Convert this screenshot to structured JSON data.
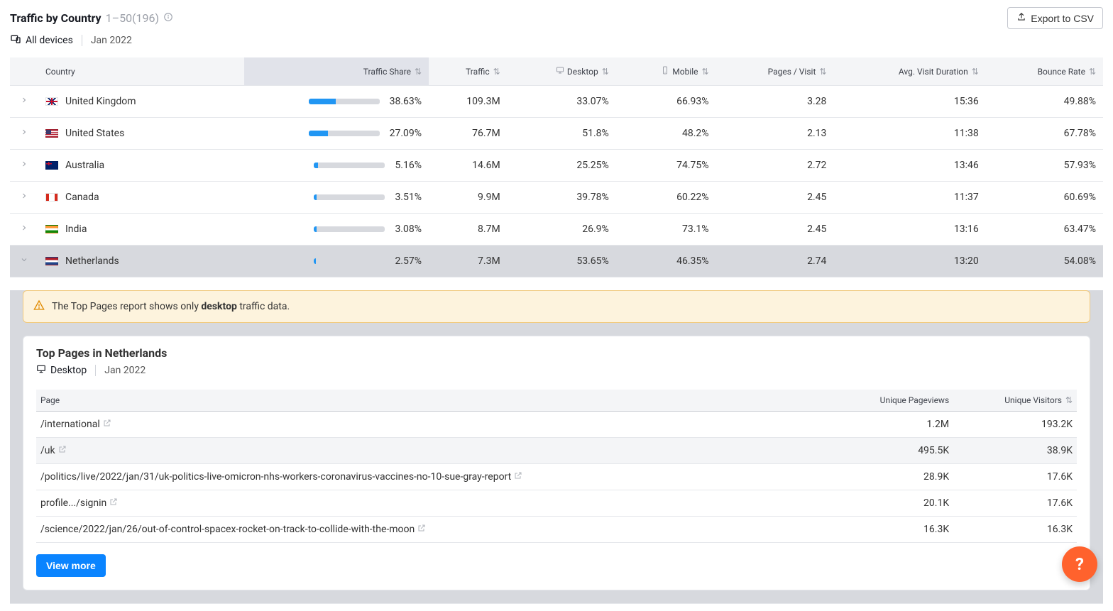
{
  "header": {
    "title": "Traffic by Country",
    "range": "1–50",
    "total": "(196)",
    "export_label": "Export to CSV"
  },
  "filters": {
    "devices": "All devices",
    "date": "Jan 2022"
  },
  "columns": {
    "country": "Country",
    "traffic_share": "Traffic Share",
    "traffic": "Traffic",
    "desktop": "Desktop",
    "mobile": "Mobile",
    "pages_visit": "Pages / Visit",
    "avg_duration": "Avg. Visit Duration",
    "bounce": "Bounce Rate"
  },
  "rows": [
    {
      "country": "United Kingdom",
      "flag": "flag-gb",
      "share": "38.63%",
      "share_pct": 38.63,
      "traffic": "109.3M",
      "desktop": "33.07%",
      "mobile": "66.93%",
      "pages": "3.28",
      "duration": "15:36",
      "bounce": "49.88%",
      "expanded": false
    },
    {
      "country": "United States",
      "flag": "flag-us",
      "share": "27.09%",
      "share_pct": 27.09,
      "traffic": "76.7M",
      "desktop": "51.8%",
      "mobile": "48.2%",
      "pages": "2.13",
      "duration": "11:38",
      "bounce": "67.78%",
      "expanded": false
    },
    {
      "country": "Australia",
      "flag": "flag-au",
      "share": "5.16%",
      "share_pct": 5.16,
      "traffic": "14.6M",
      "desktop": "25.25%",
      "mobile": "74.75%",
      "pages": "2.72",
      "duration": "13:46",
      "bounce": "57.93%",
      "expanded": false
    },
    {
      "country": "Canada",
      "flag": "flag-ca",
      "share": "3.51%",
      "share_pct": 3.51,
      "traffic": "9.9M",
      "desktop": "39.78%",
      "mobile": "60.22%",
      "pages": "2.45",
      "duration": "11:37",
      "bounce": "60.69%",
      "expanded": false
    },
    {
      "country": "India",
      "flag": "flag-in",
      "share": "3.08%",
      "share_pct": 3.08,
      "traffic": "8.7M",
      "desktop": "26.9%",
      "mobile": "73.1%",
      "pages": "2.45",
      "duration": "13:16",
      "bounce": "63.47%",
      "expanded": false
    },
    {
      "country": "Netherlands",
      "flag": "flag-nl",
      "share": "2.57%",
      "share_pct": 2.57,
      "traffic": "7.3M",
      "desktop": "53.65%",
      "mobile": "46.35%",
      "pages": "2.74",
      "duration": "13:20",
      "bounce": "54.08%",
      "expanded": true
    }
  ],
  "warning": {
    "pre": "The Top Pages report shows only ",
    "bold": "desktop",
    "post": " traffic data."
  },
  "details": {
    "title": "Top Pages in Netherlands",
    "device": "Desktop",
    "date": "Jan 2022",
    "cols": {
      "page": "Page",
      "pv": "Unique Pageviews",
      "uv": "Unique Visitors"
    },
    "rows": [
      {
        "page": "/international",
        "pv": "1.2M",
        "uv": "193.2K"
      },
      {
        "page": "/uk",
        "pv": "495.5K",
        "uv": "38.9K",
        "alt": true
      },
      {
        "page": "/politics/live/2022/jan/31/uk-politics-live-omicron-nhs-workers-coronavirus-vaccines-no-10-sue-gray-report",
        "pv": "28.9K",
        "uv": "17.6K"
      },
      {
        "page": "profile.../signin",
        "pv": "20.1K",
        "uv": "17.6K"
      },
      {
        "page": "/science/2022/jan/26/out-of-control-spacex-rocket-on-track-to-collide-with-the-moon",
        "pv": "16.3K",
        "uv": "16.3K"
      }
    ],
    "view_more": "View more"
  },
  "help": "?"
}
